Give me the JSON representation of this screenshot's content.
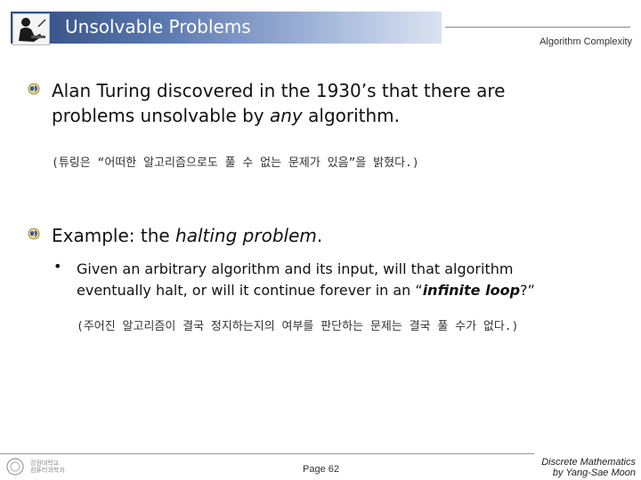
{
  "header": {
    "title": "Unsolvable Problems",
    "subtitle_right": "Algorithm Complexity",
    "bar_colors": [
      "#2f4a7c",
      "#dbe3f1"
    ]
  },
  "logo": {
    "icon": "person-at-desk-icon"
  },
  "content": {
    "bullet_icon": "globe-bullet-icon",
    "point1": {
      "line1": "Alan Turing discovered in the 1930’s that there are",
      "line2_a": "problems unsolvable by ",
      "line2_italic": "any",
      "line2_b": " algorithm.",
      "note": "(튜링은 “어떠한 알고리즘으로도 풀 수 없는 문제가 있음”을 밝혔다.)"
    },
    "point2": {
      "text_a": "Example: the ",
      "text_italic": "halting problem",
      "text_b": ".",
      "sub": {
        "bullet": "•",
        "line1": "Given an arbitrary algorithm and its input, will that algorithm",
        "line2_a": "eventually halt, or will it continue forever in an “",
        "line2_bold_italic": "infinite loop",
        "line2_b": "?”",
        "note": "(주어진 알고리즘이 결국 정지하는지의 여부를 판단하는 문제는 결국 풀 수가 없다.)"
      }
    }
  },
  "footer": {
    "logo_text_line1": "강원대학교",
    "logo_text_line2": "컴퓨터과학과",
    "page": "Page 62",
    "course": "Discrete Mathematics",
    "author": "by Yang-Sae Moon"
  }
}
